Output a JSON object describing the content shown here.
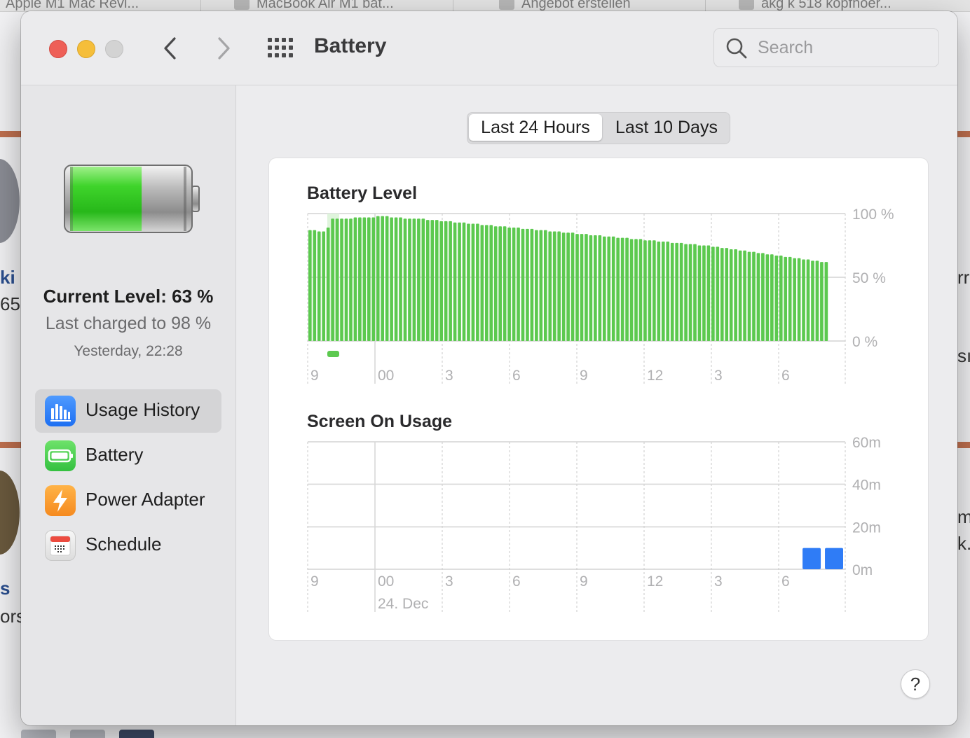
{
  "background_browser": {
    "tabs": [
      "Apple M1 Mac Revi...",
      "MacBook Air M1 bat...",
      "Angebot erstellen",
      "akg k 518 kopfhoer..."
    ],
    "page_fragments": [
      "ki",
      "65",
      "rr",
      "sı",
      "s",
      "ors",
      "m",
      "k."
    ]
  },
  "window": {
    "title": "Battery",
    "search_placeholder": "Search"
  },
  "sidebar": {
    "current_level": "Current Level: 63 %",
    "last_charged": "Last charged to 98 %",
    "charge_time": "Yesterday, 22:28",
    "battery_fill_fraction": 0.63,
    "items": [
      {
        "label": "Usage History",
        "icon": "bar-chart-icon",
        "active": true
      },
      {
        "label": "Battery",
        "icon": "battery-icon",
        "active": false
      },
      {
        "label": "Power Adapter",
        "icon": "lightning-icon",
        "active": false
      },
      {
        "label": "Schedule",
        "icon": "calendar-icon",
        "active": false
      }
    ]
  },
  "main": {
    "segments": [
      {
        "label": "Last 24 Hours",
        "selected": true
      },
      {
        "label": "Last 10 Days",
        "selected": false
      }
    ],
    "help_label": "?"
  },
  "chart_data": [
    {
      "type": "bar",
      "title": "Battery Level",
      "x_ticks": [
        "9",
        "00",
        "3",
        "6",
        "9",
        "12",
        "3",
        "6"
      ],
      "y_ticks": [
        "100 %",
        "50 %",
        "0 %"
      ],
      "ylim": [
        0,
        100
      ],
      "bar_color": "#5cc94f",
      "charging_indicator_color": "#dff4dc",
      "values": [
        87,
        87,
        86,
        86,
        89,
        96,
        96,
        96,
        96,
        96,
        97,
        97,
        97,
        97,
        97,
        98,
        98,
        98,
        97,
        97,
        97,
        96,
        96,
        96,
        96,
        96,
        95,
        95,
        95,
        94,
        94,
        94,
        93,
        93,
        93,
        92,
        92,
        92,
        91,
        91,
        91,
        90,
        90,
        90,
        89,
        89,
        89,
        88,
        88,
        88,
        87,
        87,
        87,
        86,
        86,
        86,
        85,
        85,
        85,
        84,
        84,
        84,
        83,
        83,
        83,
        82,
        82,
        82,
        81,
        81,
        81,
        80,
        80,
        80,
        79,
        79,
        79,
        78,
        78,
        78,
        77,
        77,
        77,
        76,
        76,
        76,
        75,
        75,
        75,
        74,
        74,
        73,
        73,
        72,
        72,
        71,
        71,
        70,
        70,
        69,
        69,
        68,
        68,
        67,
        67,
        66,
        66,
        65,
        65,
        64,
        64,
        63,
        63,
        62,
        62
      ]
    },
    {
      "type": "bar",
      "title": "Screen On Usage",
      "x_ticks": [
        "9",
        "00",
        "3",
        "6",
        "9",
        "12",
        "3",
        "6"
      ],
      "x_sublabel": "24. Dec",
      "y_ticks": [
        "60m",
        "40m",
        "20m",
        "0m"
      ],
      "ylim": [
        0,
        60
      ],
      "bar_color": "#2f7cf6",
      "values": [
        0,
        0,
        0,
        0,
        0,
        0,
        0,
        0,
        0,
        0,
        0,
        0,
        0,
        0,
        0,
        0,
        0,
        0,
        0,
        0,
        0,
        0,
        10,
        10
      ]
    }
  ]
}
